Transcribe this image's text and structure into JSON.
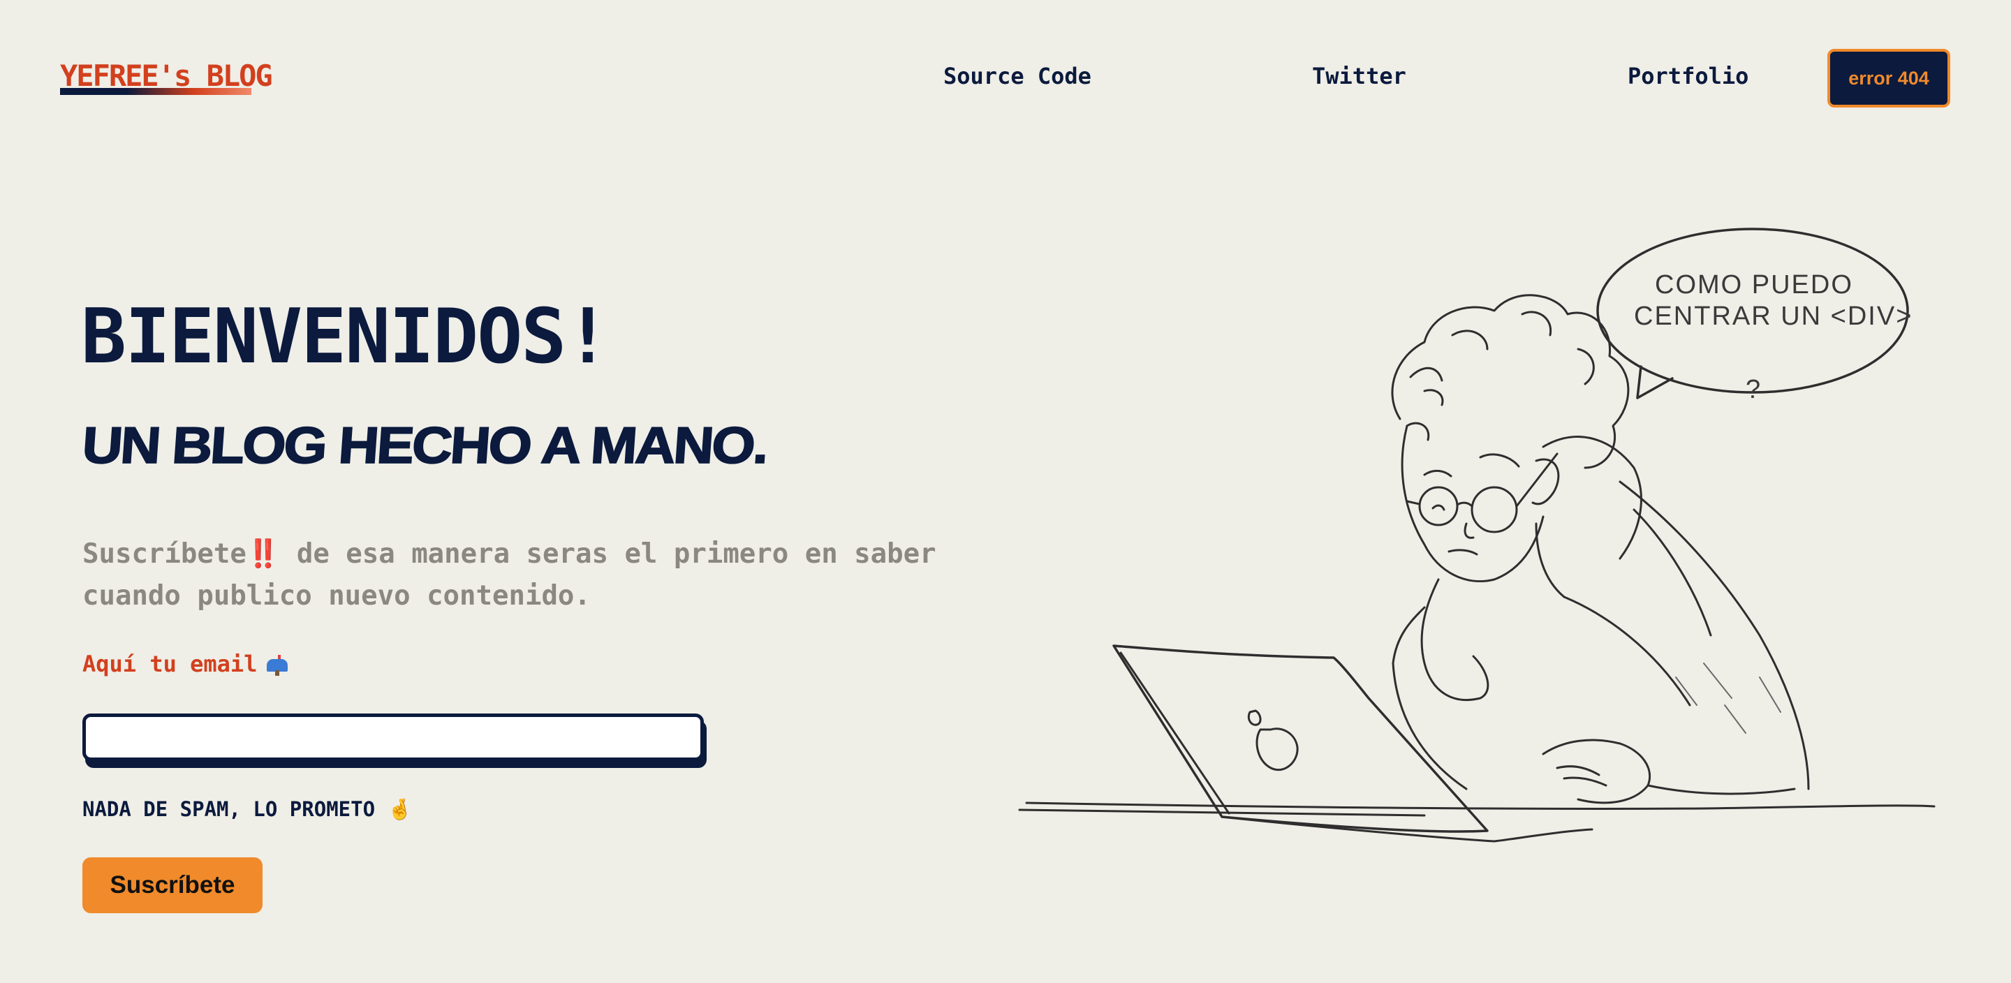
{
  "header": {
    "logo": "YEFREE's BLOG",
    "nav": [
      {
        "label": "Source Code"
      },
      {
        "label": "Twitter"
      },
      {
        "label": "Portfolio"
      }
    ],
    "cta": "error 404"
  },
  "hero": {
    "title": "BIENVENIDOS!",
    "subtitle": "UN BLOG HECHO A MANO.",
    "description": "Suscríbete‼️ de esa manera seras el primero en saber cuando publico nuevo contenido.",
    "email_label": "Aquí tu email",
    "email_value": "",
    "nospam": "NADA DE SPAM, LO PROMETO 🤞",
    "subscribe": "Suscríbete"
  },
  "illustration": {
    "speech_line1": "COMO PUEDO",
    "speech_line2": "CENTRAR UN <DIV>",
    "speech_mark": "?"
  },
  "colors": {
    "background": "#efeee7",
    "navy": "#0b1a3d",
    "accent_red": "#d2401e",
    "accent_orange": "#f08a2b",
    "muted_text": "#8a8880"
  },
  "icons": {
    "email_label_icon": "mailbox-icon"
  }
}
